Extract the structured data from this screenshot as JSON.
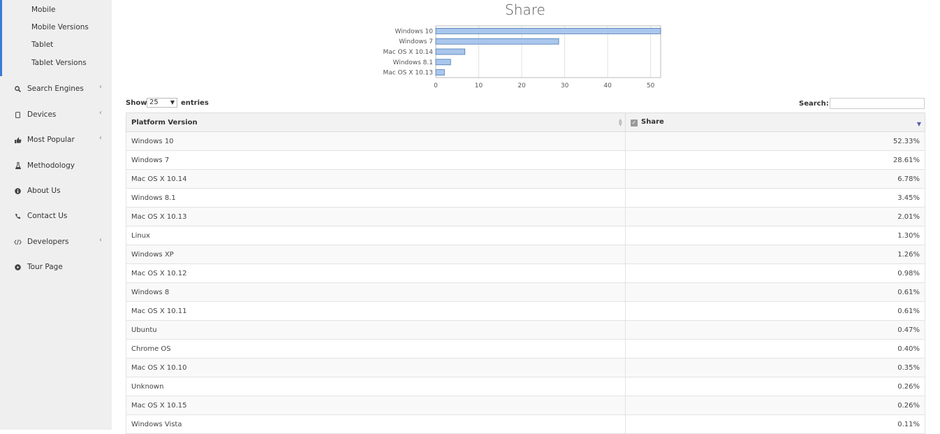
{
  "sidebar": {
    "subitems": [
      "Mobile",
      "Mobile Versions",
      "Tablet",
      "Tablet Versions"
    ],
    "items": [
      {
        "label": "Search Engines",
        "icon": "search-icon",
        "chevron": "‹"
      },
      {
        "label": "Devices",
        "icon": "tablet-icon",
        "chevron": "‹"
      },
      {
        "label": "Most Popular",
        "icon": "thumbs-up-icon",
        "chevron": "‹"
      },
      {
        "label": "Methodology",
        "icon": "flask-icon",
        "chevron": ""
      },
      {
        "label": "About Us",
        "icon": "info-icon",
        "chevron": ""
      },
      {
        "label": "Contact Us",
        "icon": "phone-icon",
        "chevron": ""
      },
      {
        "label": "Developers",
        "icon": "code-icon",
        "chevron": "‹"
      },
      {
        "label": "Tour Page",
        "icon": "play-circle-icon",
        "chevron": ""
      }
    ]
  },
  "chart_data": {
    "type": "bar",
    "orientation": "horizontal",
    "title": "Share",
    "categories": [
      "Windows 10",
      "Windows 7",
      "Mac OS X 10.14",
      "Windows 8.1",
      "Mac OS X 10.13"
    ],
    "values": [
      52.33,
      28.61,
      6.78,
      3.45,
      2.01
    ],
    "xticks": [
      0,
      10,
      20,
      30,
      40,
      50
    ],
    "xlim": [
      0,
      52.33
    ],
    "grid": true,
    "bar_color": "#a9c6ec",
    "bar_border": "#4a7ab5"
  },
  "controls": {
    "show_label": "Show",
    "page_size": "25",
    "entries_label": "entries",
    "search_label": "Search:"
  },
  "table": {
    "columns": [
      "Platform Version",
      "Share"
    ],
    "rows": [
      [
        "Windows 10",
        "52.33%"
      ],
      [
        "Windows 7",
        "28.61%"
      ],
      [
        "Mac OS X 10.14",
        "6.78%"
      ],
      [
        "Windows 8.1",
        "3.45%"
      ],
      [
        "Mac OS X 10.13",
        "2.01%"
      ],
      [
        "Linux",
        "1.30%"
      ],
      [
        "Windows XP",
        "1.26%"
      ],
      [
        "Mac OS X 10.12",
        "0.98%"
      ],
      [
        "Windows 8",
        "0.61%"
      ],
      [
        "Mac OS X 10.11",
        "0.61%"
      ],
      [
        "Ubuntu",
        "0.47%"
      ],
      [
        "Chrome OS",
        "0.40%"
      ],
      [
        "Mac OS X 10.10",
        "0.35%"
      ],
      [
        "Unknown",
        "0.26%"
      ],
      [
        "Mac OS X 10.15",
        "0.26%"
      ],
      [
        "Windows Vista",
        "0.11%"
      ]
    ]
  }
}
